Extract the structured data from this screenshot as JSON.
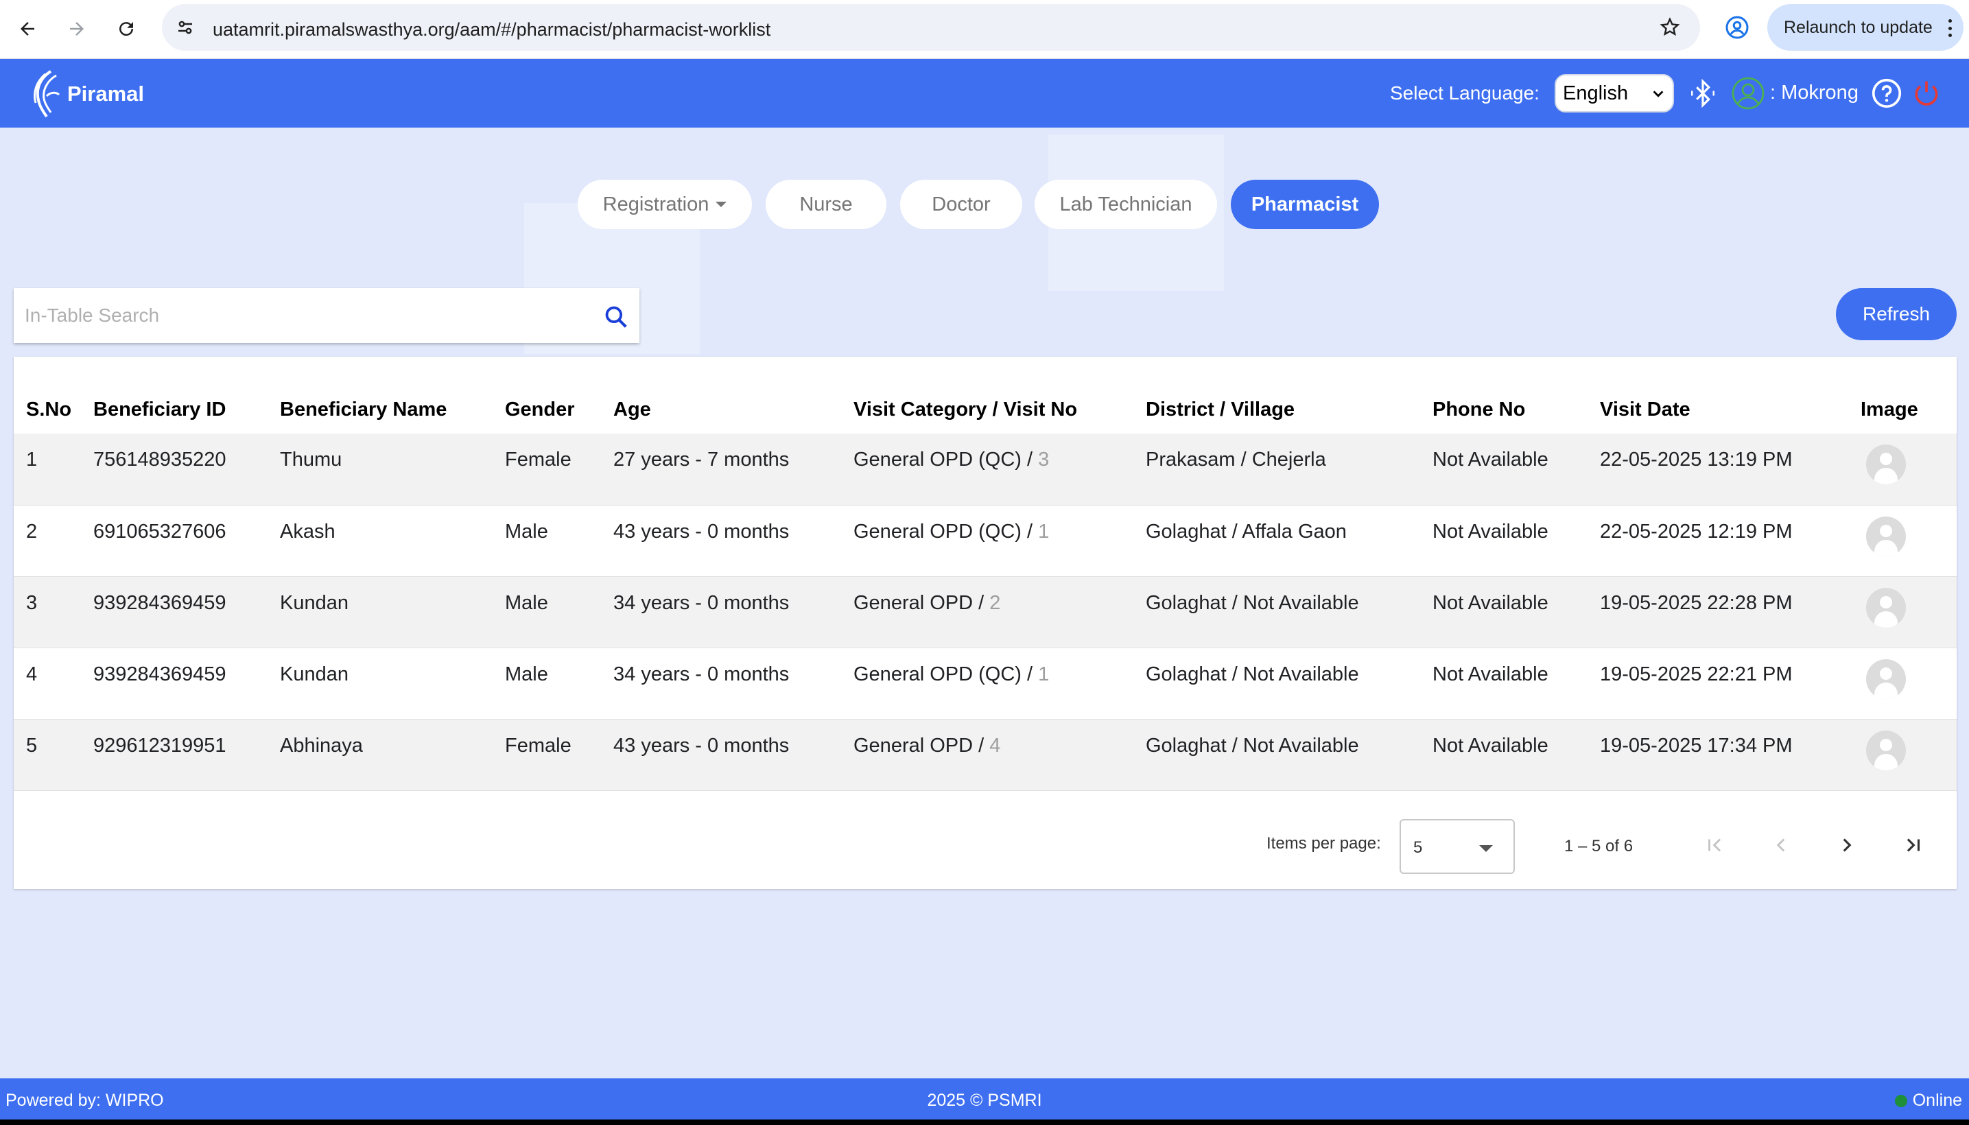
{
  "browser": {
    "url": "uatamrit.piramalswasthya.org/aam/#/pharmacist/pharmacist-worklist",
    "relaunch_label": "Relaunch to update"
  },
  "header": {
    "logo_text": "Piramal",
    "language_label": "Select Language:",
    "language_value": "English",
    "user_name": ": Mokrong"
  },
  "role_tabs": [
    {
      "label": "Registration",
      "active": false
    },
    {
      "label": "Nurse",
      "active": false
    },
    {
      "label": "Doctor",
      "active": false
    },
    {
      "label": "Lab Technician",
      "active": false
    },
    {
      "label": "Pharmacist",
      "active": true
    }
  ],
  "search": {
    "placeholder": "In-Table Search"
  },
  "refresh_label": "Refresh",
  "table": {
    "columns": [
      "S.No",
      "Beneficiary ID",
      "Beneficiary Name",
      "Gender",
      "Age",
      "Visit Category / Visit No",
      "District / Village",
      "Phone No",
      "Visit Date",
      "Image"
    ],
    "rows": [
      {
        "sno": "1",
        "id": "756148935220",
        "name": "Thumu",
        "gender": "Female",
        "age": "27 years - 7 months",
        "category": "General OPD (QC) / ",
        "visit_no": "3",
        "district": "Prakasam / Chejerla",
        "phone": "Not Available",
        "date": "22-05-2025 13:19 PM"
      },
      {
        "sno": "2",
        "id": "691065327606",
        "name": "Akash",
        "gender": "Male",
        "age": "43 years - 0 months",
        "category": "General OPD (QC) / ",
        "visit_no": "1",
        "district": "Golaghat / Affala Gaon",
        "phone": "Not Available",
        "date": "22-05-2025 12:19 PM"
      },
      {
        "sno": "3",
        "id": "939284369459",
        "name": "Kundan",
        "gender": "Male",
        "age": "34 years - 0 months",
        "category": "General OPD / ",
        "visit_no": "2",
        "district": "Golaghat / Not Available",
        "phone": "Not Available",
        "date": "19-05-2025 22:28 PM"
      },
      {
        "sno": "4",
        "id": "939284369459",
        "name": "Kundan",
        "gender": "Male",
        "age": "34 years - 0 months",
        "category": "General OPD (QC) / ",
        "visit_no": "1",
        "district": "Golaghat / Not Available",
        "phone": "Not Available",
        "date": "19-05-2025 22:21 PM"
      },
      {
        "sno": "5",
        "id": "929612319951",
        "name": "Abhinaya",
        "gender": "Female",
        "age": "43 years - 0 months",
        "category": "General OPD / ",
        "visit_no": "4",
        "district": "Golaghat / Not Available",
        "phone": "Not Available",
        "date": "19-05-2025 17:34 PM"
      }
    ]
  },
  "paginator": {
    "items_per_page_label": "Items per page:",
    "items_per_page_value": "5",
    "range_label": "1 – 5 of 6"
  },
  "footer": {
    "left": "Powered by: WIPRO",
    "center": "2025 © PSMRI",
    "status": "Online"
  },
  "colors": {
    "primary": "#3d6ff0",
    "background": "#e1e8fb",
    "online": "#1f8f3a",
    "logout": "#e53935"
  }
}
